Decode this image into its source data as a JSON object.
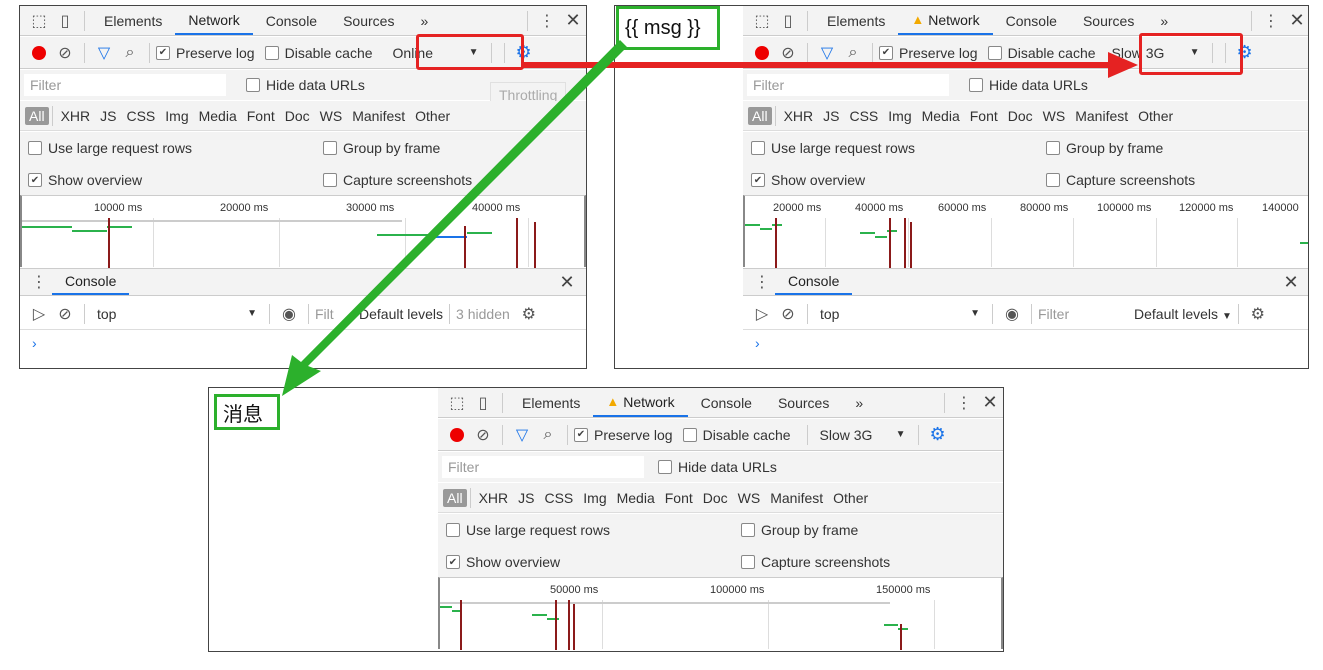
{
  "annotations": {
    "template_label": "{{ msg }}",
    "rendered_label": "消息"
  },
  "tabs": [
    "Elements",
    "Network",
    "Console",
    "Sources"
  ],
  "more_tabs": "»",
  "toolbar": {
    "preserve_log": "Preserve log",
    "disable_cache": "Disable cache"
  },
  "throttling": {
    "online": "Online",
    "slow3g": "Slow 3G",
    "tooltip": "Throttling"
  },
  "filter": {
    "placeholder": "Filter",
    "hide_data_urls": "Hide data URLs"
  },
  "types": [
    "All",
    "XHR",
    "JS",
    "CSS",
    "Img",
    "Media",
    "Font",
    "Doc",
    "WS",
    "Manifest",
    "Other"
  ],
  "options": {
    "large_rows": "Use large request rows",
    "group_by_frame": "Group by frame",
    "show_overview": "Show overview",
    "capture_screenshots": "Capture screenshots"
  },
  "overview_ticks": {
    "panel1": [
      "10000 ms",
      "20000 ms",
      "30000 ms",
      "40000 ms"
    ],
    "panel2": [
      "20000 ms",
      "40000 ms",
      "60000 ms",
      "80000 ms",
      "100000 ms",
      "120000 ms",
      "140000"
    ],
    "panel3": [
      "50000 ms",
      "100000 ms",
      "150000 ms"
    ]
  },
  "console_drawer": {
    "title": "Console",
    "context": "top",
    "filter": "Filter",
    "filter_truncated": "Filt",
    "levels": "Default levels",
    "hidden": "3 hidden",
    "prompt": "›"
  },
  "colors": {
    "green_annotation": "#2cb02c",
    "red_annotation": "#e52222",
    "accent": "#1a73e8"
  }
}
